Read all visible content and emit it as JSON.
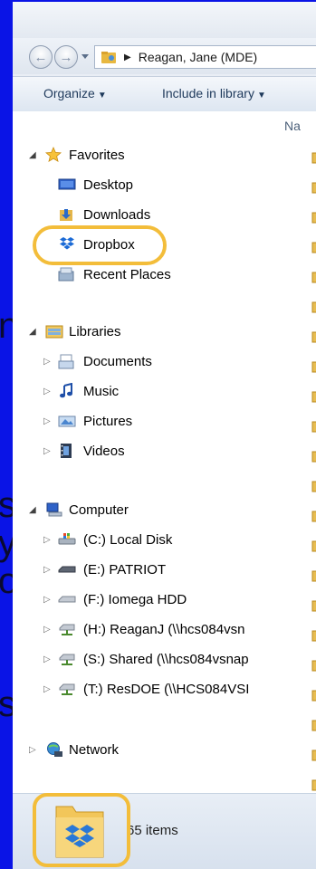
{
  "address": {
    "path_label": "Reagan, Jane (MDE)"
  },
  "toolbar": {
    "organize": "Organize",
    "include": "Include in library"
  },
  "content": {
    "column_name": "Na"
  },
  "tree": {
    "favorites": "Favorites",
    "desktop": "Desktop",
    "downloads": "Downloads",
    "dropbox": "Dropbox",
    "recent": "Recent Places",
    "libraries": "Libraries",
    "documents": "Documents",
    "music": "Music",
    "pictures": "Pictures",
    "videos": "Videos",
    "computer": "Computer",
    "drive_c": "(C:) Local Disk",
    "drive_e": "(E:) PATRIOT",
    "drive_f": "(F:) Iomega HDD",
    "drive_h": "(H:) ReaganJ (\\\\hcs084vsn",
    "drive_s": "(S:) Shared (\\\\hcs084vsnap",
    "drive_t": "(T:) ResDOE (\\\\HCS084VSI",
    "network": "Network"
  },
  "status": {
    "item_count": "65 items"
  },
  "colors": {
    "highlight": "#f3bd3a",
    "slide_background": "#0a14e6"
  }
}
